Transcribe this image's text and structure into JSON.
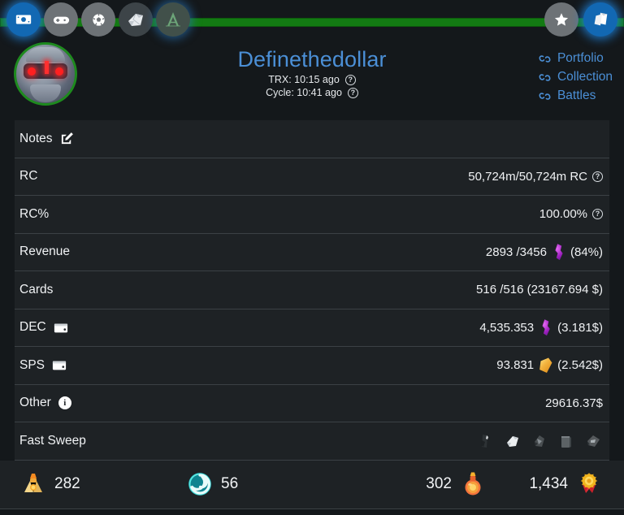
{
  "topnav": {
    "left_items": [
      {
        "name": "money-icon",
        "label": "Money",
        "state": "active"
      },
      {
        "name": "gamepad-icon",
        "label": "Game",
        "state": "inactive"
      },
      {
        "name": "soccer-ball-icon",
        "label": "Ball",
        "state": "inactive"
      },
      {
        "name": "scroll-pack-icon",
        "label": "Pack",
        "state": "inactive"
      },
      {
        "name": "land-icon",
        "label": "Land",
        "state": "dim-glow"
      }
    ],
    "right_items": [
      {
        "name": "star-icon",
        "label": "Favorites",
        "state": "inactive"
      },
      {
        "name": "cards-icon",
        "label": "Cards",
        "state": "active"
      }
    ],
    "rail_color": "#137a13"
  },
  "header": {
    "avatar_name": "user-avatar",
    "username": "Definethedollar",
    "username_color": "#4b8fd6",
    "trx_label": "TRX: 10:15 ago",
    "cycle_label": "Cycle: 10:41 ago",
    "help_glyph": "?",
    "links": [
      {
        "label": "Portfolio",
        "icon": "link-icon"
      },
      {
        "label": "Collection",
        "icon": "link-icon"
      },
      {
        "label": "Battles",
        "icon": "link-icon"
      }
    ]
  },
  "rows": [
    {
      "label": "Notes",
      "value": "",
      "label_icon": "edit-pencil-icon",
      "value_icon": ""
    },
    {
      "label": "RC",
      "value": "50,724m/50,724m RC",
      "label_icon": "",
      "value_icon": "help-circle-icon"
    },
    {
      "label": "RC%",
      "value": "100.00%",
      "label_icon": "",
      "value_icon": "help-circle-icon"
    },
    {
      "label": "Revenue",
      "value_pre": "2893 /3456",
      "value_post": "(84%)",
      "label_icon": "",
      "value_icon": "dec-token-icon"
    },
    {
      "label": "Cards",
      "value": "516 /516 (23167.694 $)",
      "label_icon": "",
      "value_icon": ""
    },
    {
      "label": "DEC",
      "value_pre": "4,535.353",
      "value_post": "(3.181$)",
      "label_icon": "wallet-icon",
      "value_icon": "dec-token-icon"
    },
    {
      "label": "SPS",
      "value_pre": "93.831",
      "value_post": "(2.542$)",
      "label_icon": "wallet-icon",
      "value_icon": "sps-token-icon"
    },
    {
      "label": "Other",
      "value": "29616.37$",
      "label_icon": "info-icon",
      "value_icon": ""
    },
    {
      "label": "Fast Sweep",
      "value": "",
      "label_icon": "",
      "value_icon": "sweep-icons"
    }
  ],
  "sweep_icons": [
    "sweep-icon-1",
    "sweep-icon-2",
    "sweep-icon-3",
    "sweep-icon-4",
    "sweep-icon-5"
  ],
  "resources": [
    {
      "icon": "merits-bag-icon",
      "value": "282",
      "order": "icon-first"
    },
    {
      "icon": "glint-spiral-icon",
      "value": "56",
      "order": "icon-first"
    },
    {
      "icon": "potion-icon",
      "value": "302",
      "order": "value-first"
    },
    {
      "icon": "medal-icon",
      "value": "1,434",
      "order": "value-first"
    }
  ],
  "colors": {
    "background": "#14181b",
    "row_bg": "#1e2225",
    "divider": "#3b4145",
    "accent_blue": "#4b8fd6",
    "green": "#137a13",
    "text": "#f0f2f4"
  }
}
